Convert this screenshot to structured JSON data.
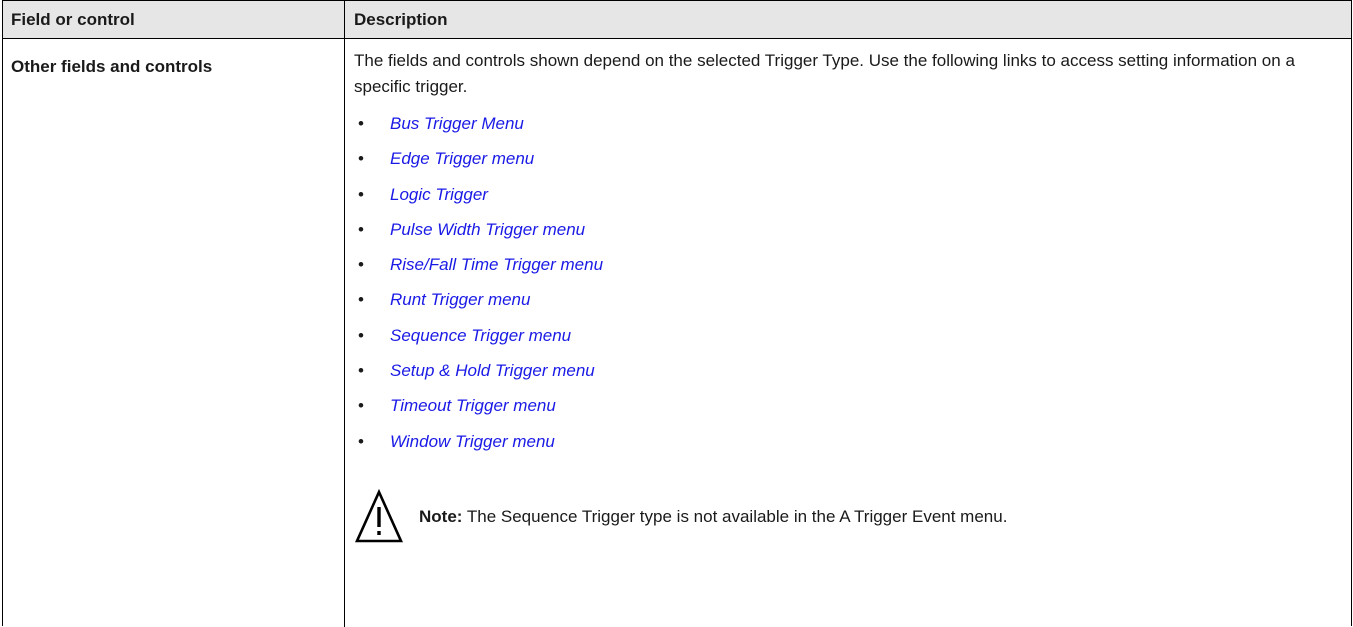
{
  "table": {
    "headers": [
      "Field or control",
      "Description"
    ],
    "rows": [
      {
        "field": "Other fields and controls",
        "description": "The fields and controls shown depend on the selected Trigger Type. Use the following links to access setting information on a specific trigger.",
        "links": [
          "Bus Trigger Menu",
          "Edge Trigger menu",
          "Logic Trigger",
          "Pulse Width Trigger menu",
          "Rise/Fall Time Trigger menu",
          "Runt Trigger menu",
          "Sequence Trigger menu",
          "Setup & Hold Trigger menu",
          "Timeout Trigger menu",
          "Window Trigger menu"
        ],
        "note": {
          "icon": "warning-triangle-icon",
          "label": "Note:",
          "text": " The Sequence Trigger type is not available in the A Trigger Event menu."
        }
      }
    ]
  },
  "colors": {
    "header_bg": "#e6e6e6",
    "link": "#1a1ae6",
    "border": "#000000"
  }
}
